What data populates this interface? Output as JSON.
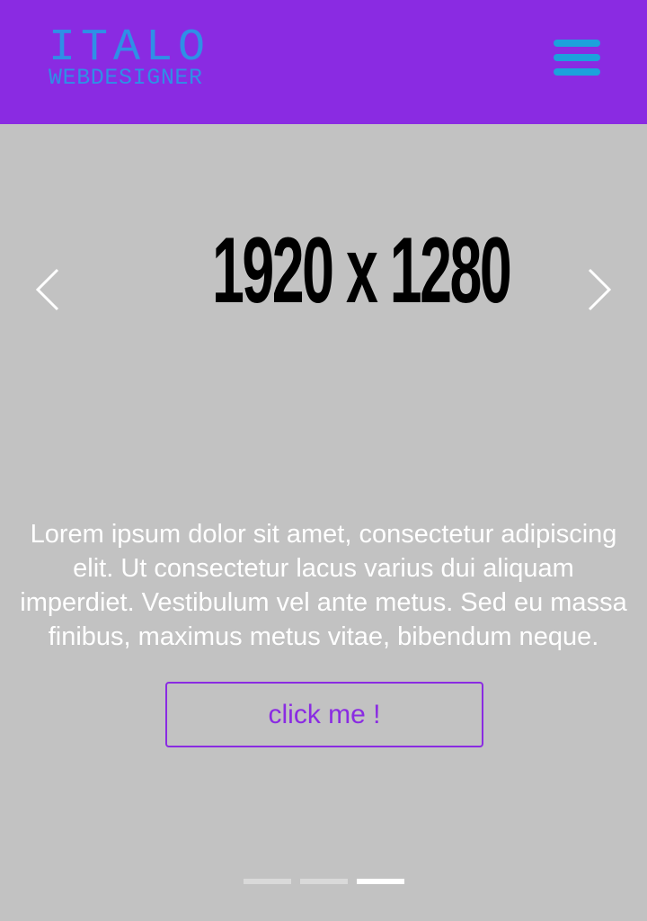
{
  "header": {
    "logo_main": "ITALO",
    "logo_sub": "WEBDESIGNER",
    "menu_icon": "hamburger-menu-icon",
    "background": "#8a2be2",
    "logo_color": "#2f8fe6",
    "menu_color": "#1ca1dc"
  },
  "slider": {
    "image_placeholder_text": "1920 x 1280",
    "prev_icon": "chevron-left-icon",
    "next_icon": "chevron-right-icon",
    "caption": "Lorem ipsum dolor sit amet, consectetur adipiscing elit. Ut consectetur lacus varius dui aliquam imperdiet. Vestibulum vel ante metus. Sed eu massa finibus, maximus metus vitae, bibendum neque.",
    "button_label": "click me !",
    "slide_count": 3,
    "active_slide": 3,
    "background": "#c2c2c2",
    "accent": "#8a2be2"
  }
}
